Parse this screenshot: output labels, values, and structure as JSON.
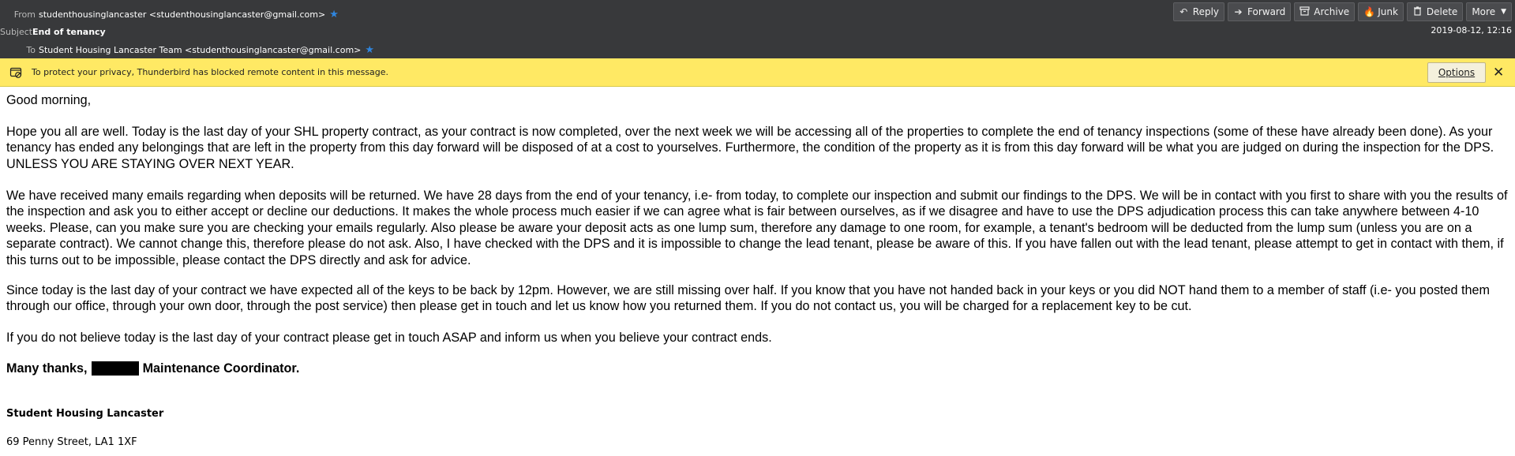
{
  "header": {
    "from_label": "From",
    "from_value": "studenthousinglancaster <studenthousinglancaster@gmail.com>",
    "subject_label": "Subject",
    "subject_value": "End of tenancy",
    "to_label": "To",
    "to_value": "Student Housing Lancaster Team <studenthousinglancaster@gmail.com>",
    "date": "2019-08-12, 12:16"
  },
  "toolbar": {
    "reply": "Reply",
    "forward": "Forward",
    "archive": "Archive",
    "junk": "Junk",
    "delete": "Delete",
    "more": "More"
  },
  "notice": {
    "text": "To protect your privacy, Thunderbird has blocked remote content in this message.",
    "options": "Options",
    "close": "✕"
  },
  "message": {
    "greeting": "Good morning,",
    "p1": "Hope you all are well. Today is the last day of your SHL property contract, as your contract is now completed, over the next week we will be accessing all of the properties to complete the end of tenancy inspections (some of these have already been done). As your tenancy has ended any belongings that are left in the property from this day forward will be disposed of at a cost to yourselves. Furthermore, the condition of the property as it is from this day forward will be what you are judged on during the inspection for the DPS. UNLESS YOU ARE STAYING OVER NEXT YEAR.",
    "p2": "We have received many emails regarding when deposits will be returned. We have 28 days from the end of your tenancy, i.e- from today, to complete our inspection and submit our findings to the DPS. We will be in contact with you first to share with you the results of the inspection and ask you to either accept or decline our deductions. It makes the whole process much easier if we can agree what is fair between ourselves, as if we disagree and have to use the DPS adjudication process this can take anywhere between 4-10 weeks. Please, can you make sure you are checking your emails regularly. Also please be aware your deposit acts as one lump sum, therefore any damage to one room, for example, a tenant's bedroom will be deducted from the lump sum (unless you are on a separate contract). We cannot change this, therefore please do not ask. Also, I have checked with the DPS and it is impossible to change the lead tenant, please be aware of this. If you have fallen out with the lead tenant, please attempt to get in contact with them, if this turns out to be impossible, please contact the DPS directly and ask for advice.",
    "p3": "Since today is the last day of your contract we have expected all of the keys to be back by 12pm. However, we are still missing over half. If you know that you have not handed back in your keys or you did NOT hand them to a member of staff (i.e- you posted them through our office, through your own door, through the post service) then please get in touch and let us know how you returned them. If you do not contact us, you will be charged for a replacement key to be cut.",
    "p4": "If you do not believe today is the last day of your contract please get in touch ASAP and inform us when you believe your contract ends.",
    "thanks": "Many thanks,",
    "role": "Maintenance Coordinator.",
    "sig_name": "Student Housing Lancaster",
    "sig_address": "69 Penny Street, LA1 1XF"
  },
  "icons": {
    "reply": "reply-icon",
    "forward": "forward-icon",
    "archive": "archive-icon",
    "junk": "junk-icon",
    "delete": "trash-icon",
    "star": "star-icon",
    "blocked": "blocked-content-icon"
  },
  "colors": {
    "header_bg": "#38393b",
    "notice_bg": "#ffe964",
    "star": "#2f86df"
  }
}
